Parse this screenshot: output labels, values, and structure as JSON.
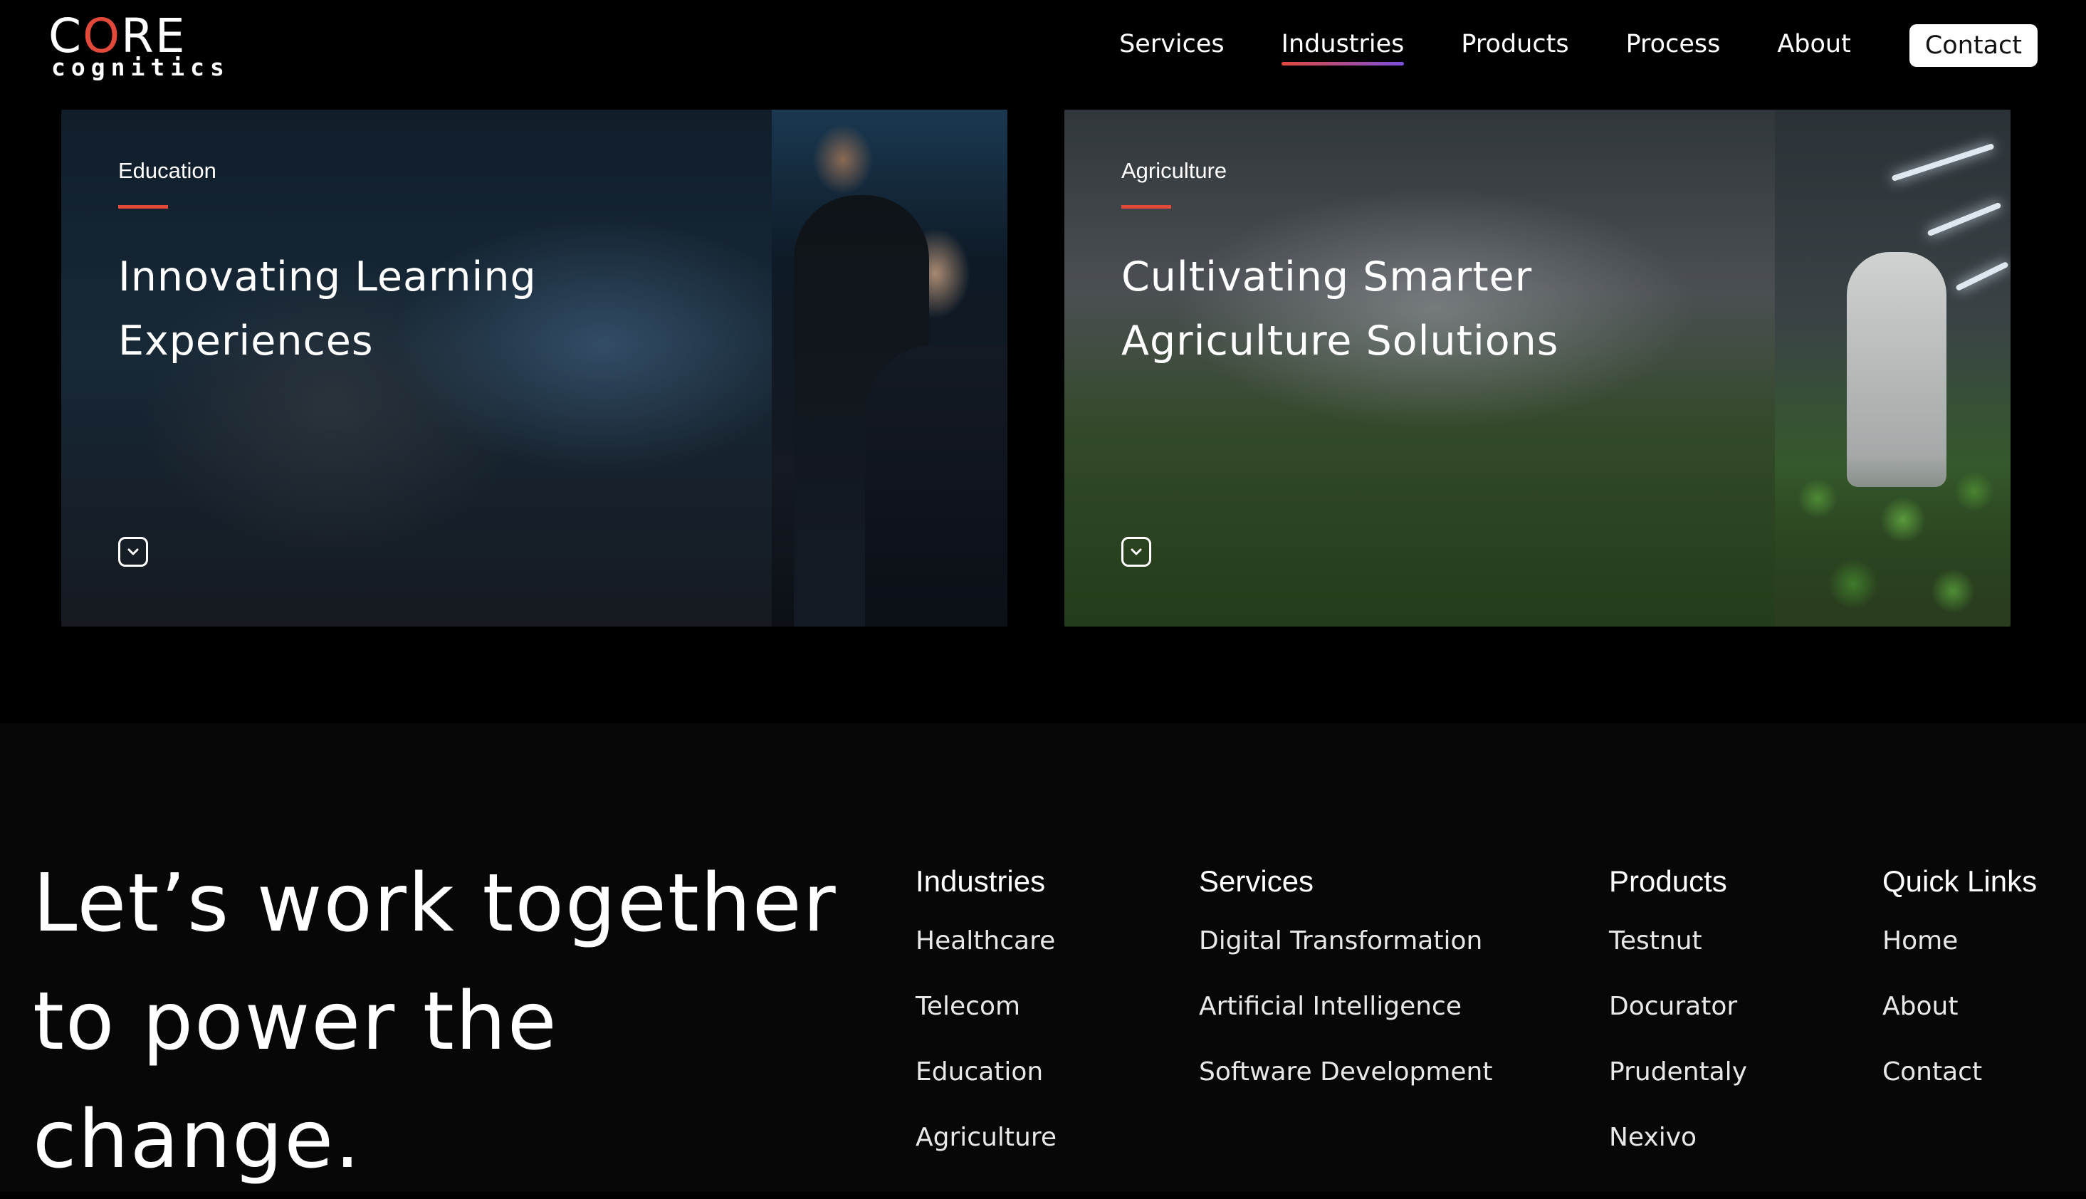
{
  "header": {
    "logo": {
      "core_prefix": "C",
      "core_mark": "O",
      "core_suffix": "RE",
      "subtitle": "cognitics"
    },
    "nav": {
      "services": "Services",
      "industries": "Industries",
      "products": "Products",
      "process": "Process",
      "about": "About",
      "contact": "Contact",
      "active": "industries"
    }
  },
  "cards": {
    "education": {
      "tag": "Education",
      "title": "Innovating Learning Experiences",
      "toggle_icon": "chevron-down-icon"
    },
    "agriculture": {
      "tag": "Agriculture",
      "title": "Cultivating Smarter Agriculture Solutions",
      "toggle_icon": "chevron-down-icon"
    }
  },
  "footer": {
    "tagline": "Let’s work together to power the change.",
    "columns": {
      "industries": {
        "title": "Industries",
        "links": [
          "Healthcare",
          "Telecom",
          "Education",
          "Agriculture"
        ]
      },
      "services": {
        "title": "Services",
        "links": [
          "Digital Transformation",
          "Artificial Intelligence",
          "Software Development"
        ]
      },
      "products": {
        "title": "Products",
        "links": [
          "Testnut",
          "Docurator",
          "Prudentaly",
          "Nexivo"
        ]
      },
      "quick_links": {
        "title": "Quick Links",
        "links": [
          "Home",
          "About",
          "Contact"
        ]
      }
    }
  },
  "colors": {
    "accent": "#e3493b",
    "accent_secondary": "#7b4fe0",
    "background": "#000000",
    "footer_background": "#070707"
  }
}
